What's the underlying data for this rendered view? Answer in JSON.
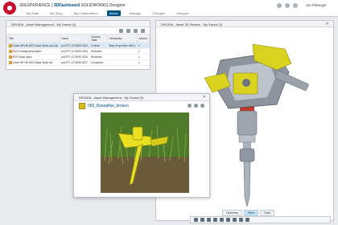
{
  "app": {
    "brand": "3DEXPERIENCE",
    "title_prefix": "3DEXPERIENCE | ",
    "title_app": "3DDashboard",
    "title_suffix": " SOLIDWORKS Designer",
    "user": "Jon Pittenger"
  },
  "nav": {
    "tabs": [
      "My Data",
      "My Story",
      "My Collaboration",
      "Model",
      "Manage",
      "Changes",
      "Lifecycle"
    ],
    "active_index": 3
  },
  "panel_left": {
    "header": "DROID8 - Asset Management - My Saved (3)",
    "columns": [
      "Title",
      "Name",
      "Maturity State",
      "Description",
      "Actions"
    ],
    "rows": [
      {
        "title": "Guest HB HB-IRCS Base Spike plus blk",
        "name": "prd-FP7-1276939 4024",
        "state": "In Work",
        "desc": "Base B sprinkler with d"
      },
      {
        "title": "IRCS HeadspikeSprinkler",
        "name": "prd-FP7-1276939 4025",
        "state": "Released",
        "desc": ""
      },
      {
        "title": "IRCS Base spike",
        "name": "prd-FP7-1276939 4026",
        "state": "Released",
        "desc": ""
      },
      {
        "title": "Guest HB HB-IRCS Base Spike blk",
        "name": "prd-FP7-1276939 4027",
        "state": "Completed",
        "desc": ""
      }
    ],
    "selected_row": 0
  },
  "panel_right": {
    "header": "DROID8 - Asset 3D Review - My Saved (3)",
    "view_tabs": [
      "Overview",
      "View",
      "Tools"
    ],
    "active_view_tab": 1
  },
  "panel_float": {
    "header": "DROID8 - Asset Management - My Saved (3)",
    "item_title": "050_Baseplike_broken"
  },
  "colors": {
    "accent": "#005386",
    "brand": "#c8102e",
    "model_yellow": "#d9d21f",
    "model_gray": "#7f8690"
  }
}
